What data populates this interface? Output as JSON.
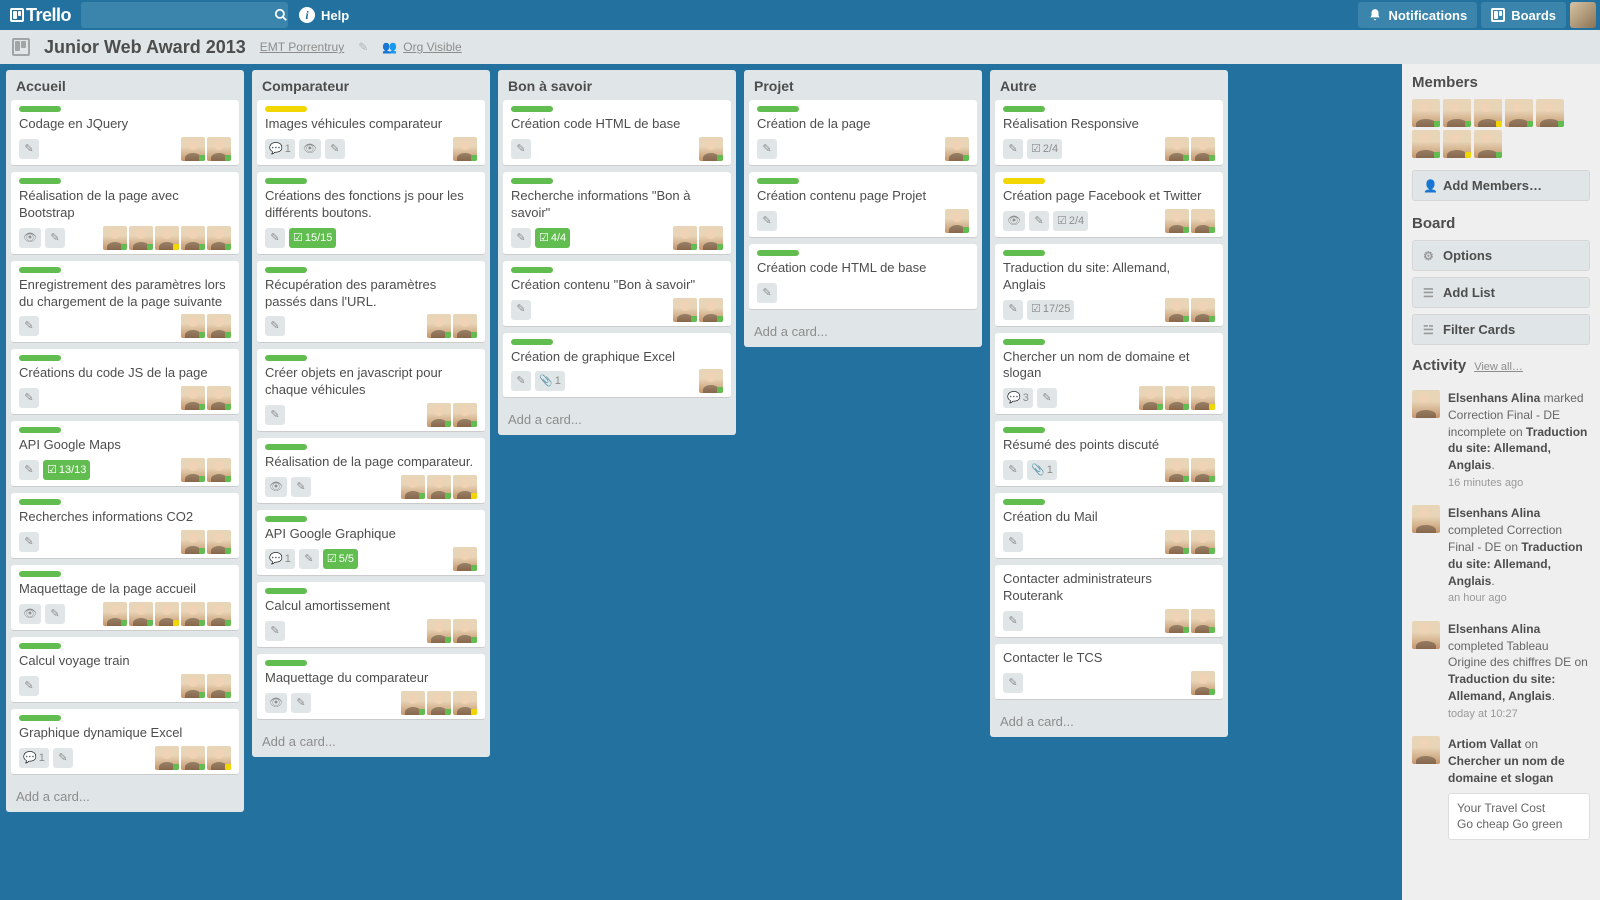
{
  "header": {
    "logo": "Trello",
    "help": "Help",
    "notifications": "Notifications",
    "boards": "Boards"
  },
  "boardHeader": {
    "title": "Junior Web Award 2013",
    "org": "EMT Porrentruy",
    "visibility": "Org Visible"
  },
  "addCard": "Add a card...",
  "sidebar": {
    "members": "Members",
    "addMembers": "Add Members…",
    "board": "Board",
    "options": "Options",
    "addList": "Add List",
    "filter": "Filter Cards",
    "activity": "Activity",
    "viewAll": "View all…"
  },
  "activity": [
    {
      "who": "Elsenhans Alina",
      "t1": " marked Correction Final - DE incomplete on ",
      "bold": "Traduction du site: Allemand, Anglais",
      "tail": ".",
      "time": "16 minutes ago"
    },
    {
      "who": "Elsenhans Alina",
      "t1": " completed Correction Final - DE on ",
      "bold": "Traduction du site: Allemand, Anglais",
      "tail": ".",
      "time": "an hour ago"
    },
    {
      "who": "Elsenhans Alina",
      "t1": " completed Tableau Origine des chiffres DE on ",
      "bold": "Traduction du site: Allemand, Anglais",
      "tail": ".",
      "time": "today at 10:27"
    },
    {
      "who": "Artiom Vallat",
      "t1": " on ",
      "bold": "Chercher un nom de domaine et slogan",
      "tail": "",
      "time": "",
      "quote": "Your Travel Cost\nGo cheap Go green"
    }
  ],
  "lists": [
    {
      "name": "Accueil",
      "cards": [
        {
          "label": "green",
          "title": "Codage en JQuery",
          "badges": [
            {
              "t": "pencil"
            }
          ],
          "members": 2
        },
        {
          "label": "green",
          "title": "Réalisation de la page avec Bootstrap",
          "badges": [
            {
              "t": "eye"
            },
            {
              "t": "pencil"
            }
          ],
          "members": 5
        },
        {
          "label": "green",
          "title": "Enregistrement des paramètres lors du chargement de la page suivante",
          "badges": [
            {
              "t": "pencil"
            }
          ],
          "members": 2
        },
        {
          "label": "green",
          "title": "Créations du code JS de la page",
          "badges": [
            {
              "t": "pencil"
            }
          ],
          "members": 2
        },
        {
          "label": "green",
          "title": "API Google Maps",
          "badges": [
            {
              "t": "pencil"
            },
            {
              "t": "check",
              "v": "13/13",
              "done": true
            }
          ],
          "members": 2
        },
        {
          "label": "green",
          "title": "Recherches informations CO2",
          "badges": [
            {
              "t": "pencil"
            }
          ],
          "members": 2
        },
        {
          "label": "green",
          "title": "Maquettage de la page accueil",
          "badges": [
            {
              "t": "eye"
            },
            {
              "t": "pencil"
            }
          ],
          "members": 5
        },
        {
          "label": "green",
          "title": "Calcul voyage train",
          "badges": [
            {
              "t": "pencil"
            }
          ],
          "members": 2
        },
        {
          "label": "green",
          "title": "Graphique dynamique Excel",
          "badges": [
            {
              "t": "comment",
              "v": "1"
            },
            {
              "t": "pencil"
            }
          ],
          "members": 3
        }
      ]
    },
    {
      "name": "Comparateur",
      "cards": [
        {
          "label": "yellow",
          "title": "Images véhicules comparateur",
          "badges": [
            {
              "t": "comment",
              "v": "1"
            },
            {
              "t": "eye"
            },
            {
              "t": "pencil"
            }
          ],
          "members": 1
        },
        {
          "label": "green",
          "title": "Créations des fonctions js pour les différents boutons.",
          "badges": [
            {
              "t": "pencil"
            },
            {
              "t": "check",
              "v": "15/15",
              "done": true
            }
          ],
          "members": 0
        },
        {
          "label": "green",
          "title": "Récupération des paramètres passés dans l'URL.",
          "badges": [
            {
              "t": "pencil"
            }
          ],
          "members": 2
        },
        {
          "label": "green",
          "title": "Créer objets en javascript pour chaque véhicules",
          "badges": [
            {
              "t": "pencil"
            }
          ],
          "members": 2
        },
        {
          "label": "green",
          "title": "Réalisation de la page comparateur.",
          "badges": [
            {
              "t": "eye"
            },
            {
              "t": "pencil"
            }
          ],
          "members": 3
        },
        {
          "label": "green",
          "title": "API Google Graphique",
          "badges": [
            {
              "t": "comment",
              "v": "1"
            },
            {
              "t": "pencil"
            },
            {
              "t": "check",
              "v": "5/5",
              "done": true
            }
          ],
          "members": 1
        },
        {
          "label": "green",
          "title": "Calcul amortissement",
          "badges": [
            {
              "t": "pencil"
            }
          ],
          "members": 2
        },
        {
          "label": "green",
          "title": "Maquettage du comparateur",
          "badges": [
            {
              "t": "eye"
            },
            {
              "t": "pencil"
            }
          ],
          "members": 3
        }
      ]
    },
    {
      "name": "Bon à savoir",
      "cards": [
        {
          "label": "green",
          "title": "Création code HTML de base",
          "badges": [
            {
              "t": "pencil"
            }
          ],
          "members": 1
        },
        {
          "label": "green",
          "title": "Recherche informations \"Bon à savoir\"",
          "badges": [
            {
              "t": "pencil"
            },
            {
              "t": "check",
              "v": "4/4",
              "done": true
            }
          ],
          "members": 2
        },
        {
          "label": "green",
          "title": "Création contenu \"Bon à savoir\"",
          "badges": [
            {
              "t": "pencil"
            }
          ],
          "members": 2
        },
        {
          "label": "green",
          "title": "Création de graphique Excel",
          "badges": [
            {
              "t": "pencil"
            },
            {
              "t": "attach",
              "v": "1"
            }
          ],
          "members": 1
        }
      ]
    },
    {
      "name": "Projet",
      "cards": [
        {
          "label": "green",
          "title": "Création de la page",
          "badges": [
            {
              "t": "pencil"
            }
          ],
          "members": 1
        },
        {
          "label": "green",
          "title": "Création contenu page Projet",
          "badges": [
            {
              "t": "pencil"
            }
          ],
          "members": 1
        },
        {
          "label": "green",
          "title": "Création code HTML de base",
          "badges": [
            {
              "t": "pencil"
            }
          ],
          "members": 0
        }
      ]
    },
    {
      "name": "Autre",
      "cards": [
        {
          "label": "green",
          "title": "Réalisation Responsive",
          "badges": [
            {
              "t": "pencil"
            },
            {
              "t": "check",
              "v": "2/4"
            }
          ],
          "members": 2
        },
        {
          "label": "yellow",
          "title": "Création page Facebook et Twitter",
          "badges": [
            {
              "t": "eye"
            },
            {
              "t": "pencil"
            },
            {
              "t": "check",
              "v": "2/4"
            }
          ],
          "members": 2
        },
        {
          "label": "green",
          "title": "Traduction du site: Allemand, Anglais",
          "badges": [
            {
              "t": "pencil"
            },
            {
              "t": "check",
              "v": "17/25"
            }
          ],
          "members": 2
        },
        {
          "label": "green",
          "title": "Chercher un nom de domaine et slogan",
          "badges": [
            {
              "t": "comment",
              "v": "3"
            },
            {
              "t": "pencil"
            }
          ],
          "members": 3
        },
        {
          "label": "green",
          "title": "Résumé des points discuté",
          "badges": [
            {
              "t": "pencil"
            },
            {
              "t": "attach",
              "v": "1"
            }
          ],
          "members": 2
        },
        {
          "label": "green",
          "title": "Création du Mail",
          "badges": [
            {
              "t": "pencil"
            }
          ],
          "members": 2
        },
        {
          "label": "",
          "title": "Contacter administrateurs Routerank",
          "badges": [
            {
              "t": "pencil"
            }
          ],
          "members": 2
        },
        {
          "label": "",
          "title": "Contacter le TCS",
          "badges": [
            {
              "t": "pencil"
            }
          ],
          "members": 1
        }
      ]
    }
  ]
}
